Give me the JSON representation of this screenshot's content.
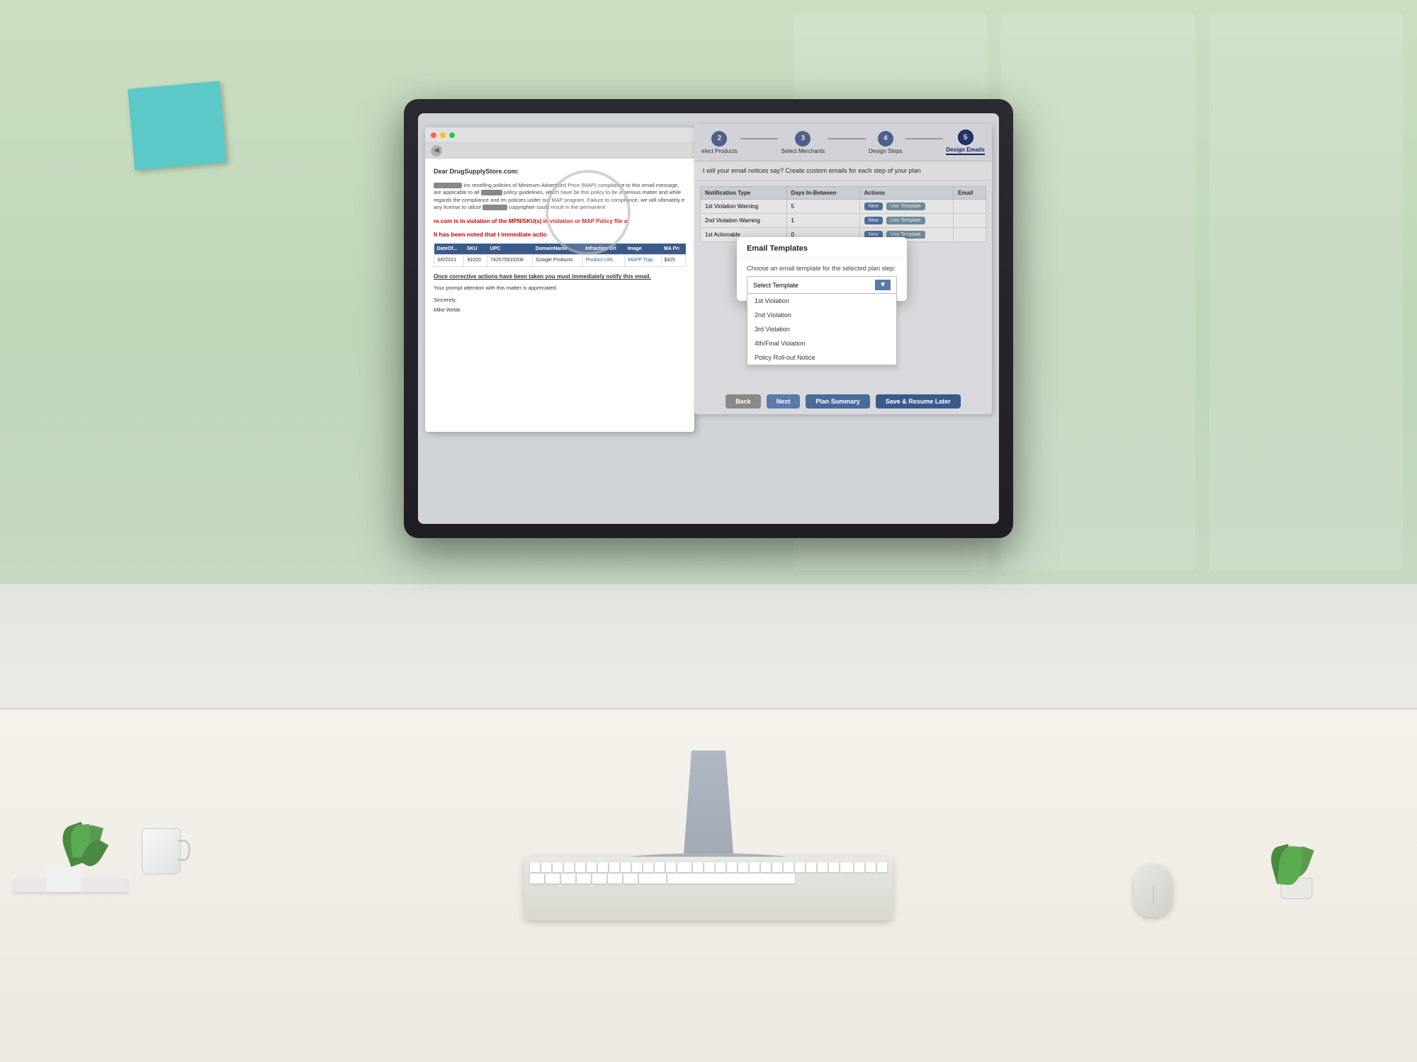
{
  "scene": {
    "bg_color": "#c8d8c0"
  },
  "sticky_note": {
    "color": "#5cc8c8"
  },
  "email_doc": {
    "toolbar_dots": [
      "red",
      "yellow",
      "green"
    ],
    "greeting": "Dear DrugSupplyStore.com:",
    "body_intro": " Inc reselling policies of Minimum Advertised Price (MAP) compliance to this email message, are applicable to all policy guidelines, which have be this policy to be a serious matter and while regards the compliance and en policies under our MAP program. Failure to c compliance, we will ultimately e any license to utilize copyrighter could result in the permanent",
    "violation_text": "re.com is in violation of the MPN/SKU(s) in violation or MAP Policy file a",
    "noted_text": "It has been noted that t immediate actio",
    "table": {
      "headers": [
        "DateOf...",
        "SKU",
        "UPC",
        "DomainName",
        "Infraction Url",
        "Image",
        "MA Pri"
      ],
      "rows": [
        {
          "date": "3/6/2021",
          "sku": "91020",
          "upc": "742575910208",
          "domain": "Google Products",
          "infraction_url": "Product URL",
          "image": "MAPP Trap",
          "price": "$425"
        }
      ]
    },
    "corrective_text": "Once corrective actions have been taken you must immediately notify this email.",
    "prompt_text": "Your prompt attention with this matter is appreciated.",
    "sincerely": "Sincerely,",
    "signature": "Mike Webb"
  },
  "app_panel": {
    "steps": [
      {
        "number": "2",
        "label": "elect Products",
        "active": false
      },
      {
        "number": "3",
        "label": "Select Merchants",
        "active": false
      },
      {
        "number": "4",
        "label": "Design Steps",
        "active": false
      },
      {
        "number": "5",
        "label": "Design Emails",
        "active": true
      }
    ],
    "subtitle": "t will your email notices say? Create custom emails for each step of your plan",
    "table": {
      "headers": [
        "Notification Type",
        "Days In-Between",
        "Actions",
        "Email"
      ],
      "rows": [
        {
          "type": "1st Violation Warning",
          "days": "5",
          "btn_new": "New",
          "btn_template": "Use Template"
        },
        {
          "type": "2nd Violation Warning",
          "days": "1",
          "btn_new": "New",
          "btn_template": "Use Template"
        },
        {
          "type": "1st Actionable",
          "days": "0",
          "btn_new": "New",
          "btn_template": "Use Template"
        }
      ]
    },
    "footer_buttons": {
      "back": "Back",
      "next": "Next",
      "plan_summary": "Plan Summary",
      "save_resume": "Save & Resume Later"
    }
  },
  "modal": {
    "title": "Email Templates",
    "description": "Choose an email template for the selected plan step:",
    "select_placeholder": "Select Template",
    "dropdown_options": [
      "1st Violation",
      "2nd Violation",
      "3rd Violation",
      "4th/Final Violation",
      "Policy Roll-out Notice"
    ]
  },
  "detected_text": {
    "product": "Product"
  }
}
